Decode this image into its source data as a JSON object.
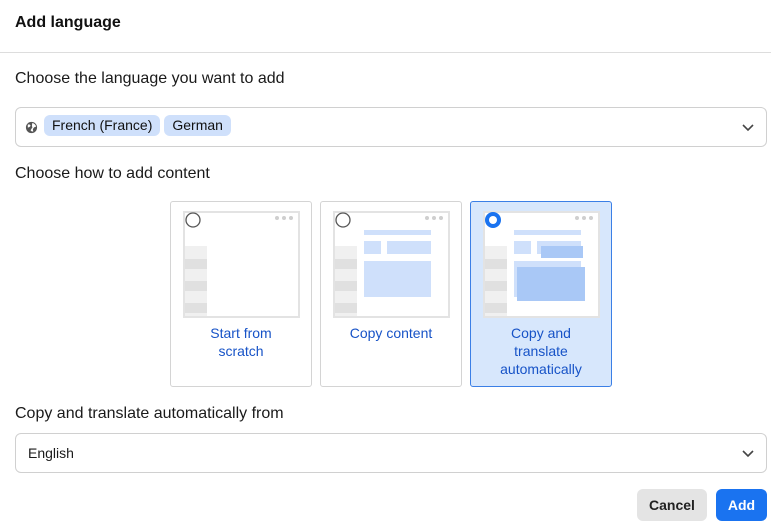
{
  "dialog": {
    "title": "Add language"
  },
  "languages_section": {
    "label": "Choose the language you want to add",
    "selected": [
      "French (France)",
      "German"
    ],
    "icon": "globe-icon"
  },
  "method_section": {
    "label": "Choose how to add content",
    "options": [
      {
        "label": "Start from scratch",
        "selected": false
      },
      {
        "label": "Copy content",
        "selected": false
      },
      {
        "label": "Copy and translate automatically",
        "selected": true
      }
    ]
  },
  "source_section": {
    "label": "Copy and translate automatically from",
    "value": "English"
  },
  "actions": {
    "cancel_label": "Cancel",
    "add_label": "Add"
  },
  "colors": {
    "accent": "#1a73f0",
    "chip": "#cfe0fb",
    "selected_card": "#d7e7fc",
    "link_text": "#1753c7"
  }
}
